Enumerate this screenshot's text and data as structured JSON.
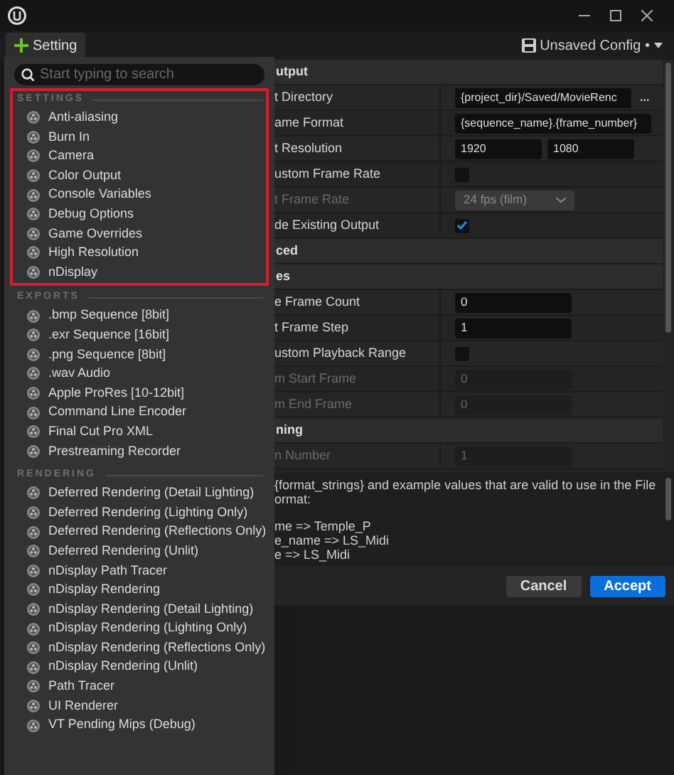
{
  "toolbar": {
    "add_button": "Setting",
    "config": "Unsaved Config •"
  },
  "menu": {
    "search": {
      "placeholder": "Start typing to search"
    },
    "sections": [
      {
        "title": "SETTINGS",
        "highlighted": true,
        "items": [
          "Anti-aliasing",
          "Burn In",
          "Camera",
          "Color Output",
          "Console Variables",
          "Debug Options",
          "Game Overrides",
          "High Resolution",
          "nDisplay"
        ]
      },
      {
        "title": "EXPORTS",
        "highlighted": false,
        "items": [
          ".bmp Sequence [8bit]",
          ".exr Sequence [16bit]",
          ".png Sequence [8bit]",
          ".wav Audio",
          "Apple ProRes [10-12bit]",
          "Command Line Encoder",
          "Final Cut Pro XML",
          "Prestreaming Recorder"
        ]
      },
      {
        "title": "RENDERING",
        "highlighted": false,
        "items": [
          "Deferred Rendering (Detail Lighting)",
          "Deferred Rendering (Lighting Only)",
          "Deferred Rendering (Reflections Only)",
          "Deferred Rendering (Unlit)",
          "nDisplay Path Tracer",
          "nDisplay Rendering",
          "nDisplay Rendering (Detail Lighting)",
          "nDisplay Rendering (Lighting Only)",
          "nDisplay Rendering (Reflections Only)",
          "nDisplay Rendering (Unlit)",
          "Path Tracer",
          "UI Renderer",
          "VT Pending Mips (Debug)"
        ]
      }
    ]
  },
  "panel": {
    "rows": [
      {
        "kind": "header",
        "label": "utput"
      },
      {
        "kind": "path",
        "label": "t Directory",
        "value": "{project_dir}/Saved/MovieRenc",
        "browse": "..."
      },
      {
        "kind": "text",
        "label": "ame Format",
        "value": "{sequence_name}.{frame_number}"
      },
      {
        "kind": "pair",
        "label": "t Resolution",
        "values": [
          "1920",
          "1080"
        ]
      },
      {
        "kind": "check",
        "label": "ustom Frame Rate",
        "checked": false
      },
      {
        "kind": "select",
        "label": "t Frame Rate",
        "value": "24 fps (film)",
        "disabled": true
      },
      {
        "kind": "check",
        "label": "de Existing Output",
        "checked": true
      },
      {
        "kind": "header",
        "label": "ced"
      },
      {
        "kind": "header",
        "label": "es"
      },
      {
        "kind": "number",
        "label": "e Frame Count",
        "value": "0",
        "disabled": false
      },
      {
        "kind": "number",
        "label": "t Frame Step",
        "value": "1",
        "disabled": false
      },
      {
        "kind": "check",
        "label": "ustom Playback Range",
        "checked": false
      },
      {
        "kind": "number",
        "label": "m Start Frame",
        "value": "0",
        "disabled": true
      },
      {
        "kind": "number",
        "label": "m End Frame",
        "value": "0",
        "disabled": true
      },
      {
        "kind": "header",
        "label": "ning"
      },
      {
        "kind": "number",
        "label": "n Number",
        "value": "1",
        "disabled": true
      }
    ],
    "description": [
      [
        "{format_strings} and example values that are valid to use in the File",
        "ormat:"
      ],
      [
        "me => Temple_P",
        "e_name => LS_Midi",
        "e => LS_Midi"
      ]
    ]
  },
  "buttons": [
    {
      "label": "Cancel",
      "kind": "secondary"
    },
    {
      "label": "Accept",
      "kind": "primary"
    }
  ]
}
